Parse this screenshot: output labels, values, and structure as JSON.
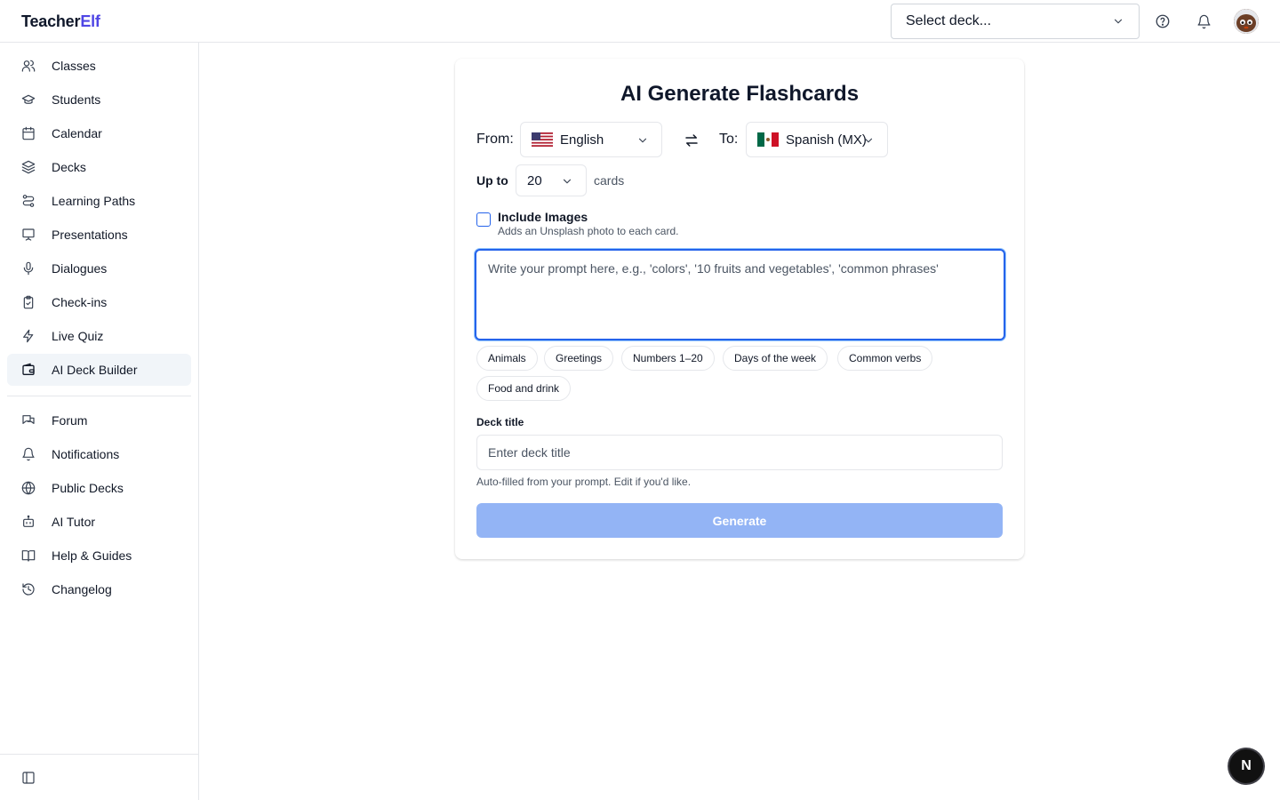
{
  "header": {
    "logo_part1": "Teacher",
    "logo_part2": "Elf",
    "deck_select_label": "Select deck...",
    "icons": [
      "help-icon",
      "bell-icon",
      "avatar"
    ]
  },
  "sidebar": {
    "items": [
      {
        "label": "Classes",
        "icon": "users-icon"
      },
      {
        "label": "Students",
        "icon": "graduation-cap-icon"
      },
      {
        "label": "Calendar",
        "icon": "calendar-icon"
      },
      {
        "label": "Decks",
        "icon": "layers-icon"
      },
      {
        "label": "Learning Paths",
        "icon": "route-icon"
      },
      {
        "label": "Presentations",
        "icon": "presentation-icon"
      },
      {
        "label": "Dialogues",
        "icon": "microphone-icon"
      },
      {
        "label": "Check-ins",
        "icon": "clipboard-check-icon"
      },
      {
        "label": "Live Quiz",
        "icon": "zap-icon"
      },
      {
        "label": "AI Deck Builder",
        "icon": "wallet-icon",
        "active": true
      }
    ],
    "secondary_items": [
      {
        "label": "Forum",
        "icon": "messages-icon"
      },
      {
        "label": "Notifications",
        "icon": "bell-icon"
      },
      {
        "label": "Public Decks",
        "icon": "globe-icon"
      },
      {
        "label": "AI Tutor",
        "icon": "bot-icon"
      },
      {
        "label": "Help & Guides",
        "icon": "book-open-icon"
      },
      {
        "label": "Changelog",
        "icon": "history-icon"
      }
    ]
  },
  "form": {
    "title": "AI Generate Flashcards",
    "from_label": "From:",
    "from_language": "English",
    "to_label": "To:",
    "to_language": "Spanish (MX)",
    "up_to_label": "Up to",
    "count_value": "20",
    "cards_label": "cards",
    "include_images_label": "Include Images",
    "include_images_hint": "Adds an Unsplash photo to each card.",
    "prompt_placeholder": "Write your prompt here, e.g., 'colors', '10 fruits and vegetables', 'common phrases'",
    "suggestions": [
      "Animals",
      "Greetings",
      "Numbers 1–20",
      "Days of the week",
      "Common verbs",
      "Food and drink"
    ],
    "deck_title_label": "Deck title",
    "deck_title_placeholder": "Enter deck title",
    "deck_title_hint": "Auto-filled from your prompt. Edit if you'd like.",
    "generate_label": "Generate"
  },
  "fab_label": "N",
  "colors": {
    "accent": "#4f46e5",
    "focus_blue": "#2563eb",
    "generate_disabled": "#93b4f5"
  }
}
